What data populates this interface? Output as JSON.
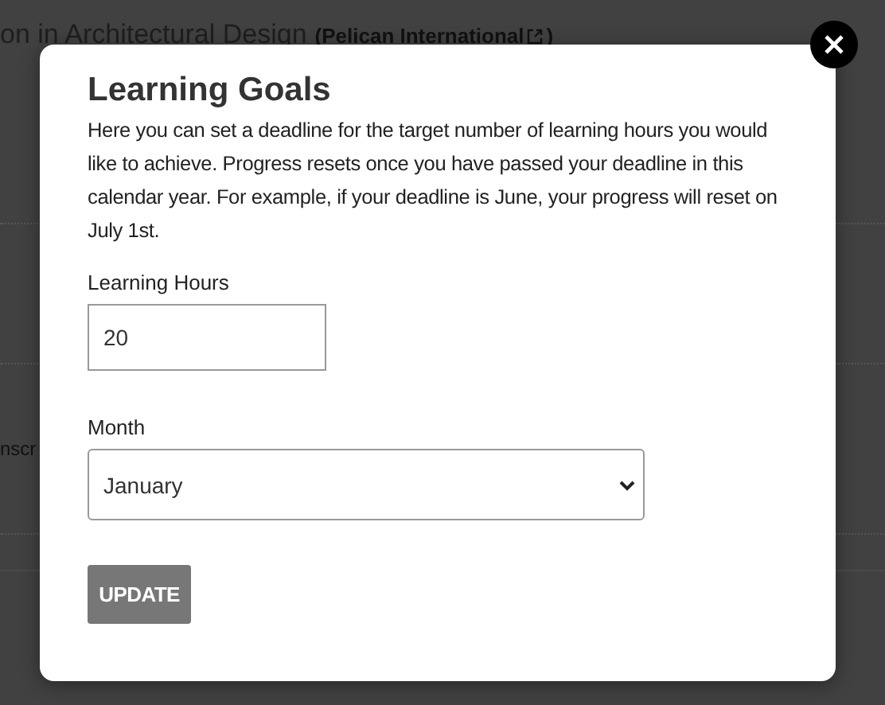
{
  "background": {
    "heading": "on in Architectural Design",
    "publisher": "(Pelican International",
    "publisher_close": ")",
    "fragment": "nscr"
  },
  "dialog": {
    "title": "Learning Goals",
    "description": "Here you can set a deadline for the target number of learning hours you would like to achieve. Progress resets once you have passed your deadline in this calendar year. For example, if your deadline is June, your progress will reset on July 1st.",
    "fields": [
      {
        "kind": "text",
        "label": "Learning Hours",
        "value": "20"
      },
      {
        "kind": "select",
        "label": "Month",
        "value": "January"
      }
    ],
    "button": "UPDATE"
  }
}
